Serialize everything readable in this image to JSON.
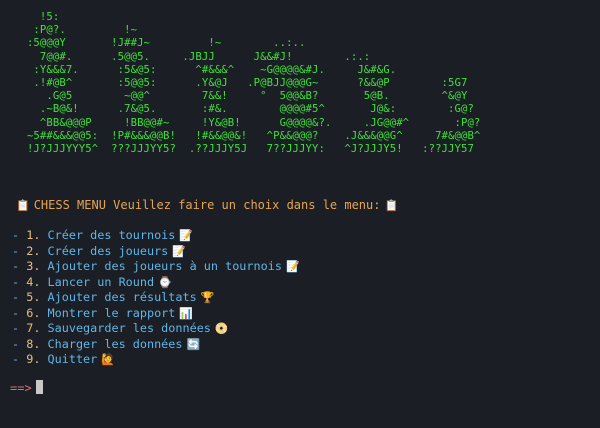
{
  "ascii_art": "    !5:\n   :P@?.         !~\n  :5@@@Y       !J##J~         !~        ..:..\n    7@@#.      .5@@5.     .JBJJ      J&&#J!        .:.:\n   :Y&&&7.      :5&@5:      ^#&&&^    ~G@@@@&#J.     J&#&G.\n   .!#@B^       :5@@5:      .Y&@J   .P@BJJ@@@G~      ?&&@P        :5G7\n     .G@5        ~@@^        7&&!     °  5@@&B?       5@B.        ^&@Y\n    .~B@&!      .7&@5.       :#&.        @@@@#5^       J@&:        :G@?\n    ^BB&@@@P     !BB@@#~     !Y&@B!      G@@@@&?.     .JG@@#^       :P@?\n  ~5##&&&@@5:  !P#&&&@@B!   !#&&@@&!   ^P&&@@@?    .J&&&@@G^     7#&@@B^\n  !J?JJJYYY5^  ???JJJYY5?  .??JJJY5J   7??JJJYY:   ^J?JJJY5!   :??JJY57",
  "title": {
    "icon_left": "clipboard-icon",
    "text": "CHESS MENU Veuillez faire un choix dans le menu:",
    "icon_right": "clipboard-icon",
    "color": "#e8a54f"
  },
  "menu_items": [
    {
      "num": "1.",
      "label": "Créer des tournois",
      "icon": "memo-icon",
      "glyph": "📝"
    },
    {
      "num": "2.",
      "label": "Créer des joueurs",
      "icon": "memo-icon",
      "glyph": "📝"
    },
    {
      "num": "3.",
      "label": "Ajouter des joueurs à un tournois",
      "icon": "memo-icon",
      "glyph": "📝"
    },
    {
      "num": "4.",
      "label": "Lancer un Round",
      "icon": "stopwatch-icon",
      "glyph": "⌚"
    },
    {
      "num": "5.",
      "label": "Ajouter des résultats",
      "icon": "trophy-icon",
      "glyph": "🏆"
    },
    {
      "num": "6.",
      "label": "Montrer le rapport",
      "icon": "bar-chart-icon",
      "glyph": "📊"
    },
    {
      "num": "7.",
      "label": "Sauvegarder les données",
      "icon": "disk-icon",
      "glyph": "📀"
    },
    {
      "num": "8.",
      "label": "Charger les données",
      "icon": "refresh-icon",
      "glyph": "🔄"
    },
    {
      "num": "9.",
      "label": "Quitter",
      "icon": "raising-hand-icon",
      "glyph": "🙋"
    }
  ],
  "prompt": {
    "text": "==>",
    "color": "#e06c75"
  },
  "colors": {
    "background": "#1b1e24",
    "ascii": "#3ee23a",
    "menu_label": "#5fb6e8",
    "menu_number": "#e5c07b"
  }
}
